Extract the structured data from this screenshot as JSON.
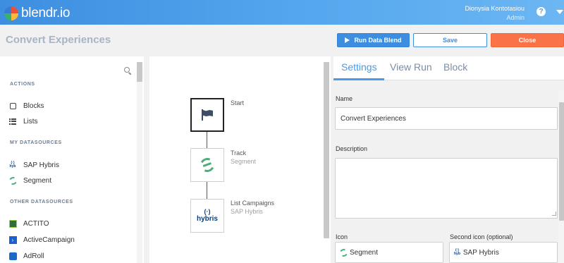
{
  "app": {
    "brand": "blendr.io"
  },
  "user": {
    "name": "Dionysia Kontotasiou",
    "role": "Admin"
  },
  "header": {
    "help_glyph": "?"
  },
  "page": {
    "title": "Convert Experiences"
  },
  "toolbar": {
    "run_label": "Run Data Blend",
    "save_label": "Save",
    "close_label": "Close"
  },
  "sidebar": {
    "actions_heading": "ACTIONS",
    "actions": [
      {
        "label": "Blocks",
        "icon": "square-icon"
      },
      {
        "label": "Lists",
        "icon": "list-icon"
      }
    ],
    "my_heading": "MY DATASOURCES",
    "my_datasources": [
      {
        "label": "SAP Hybris",
        "icon": "sap-hybris-icon"
      },
      {
        "label": "Segment",
        "icon": "segment-icon"
      }
    ],
    "other_heading": "OTHER DATASOURCES",
    "other_datasources": [
      {
        "label": "ACTITO",
        "icon": "actito-icon"
      },
      {
        "label": "ActiveCampaign",
        "icon": "activecampaign-icon"
      },
      {
        "label": "AdRoll",
        "icon": "adroll-icon"
      }
    ]
  },
  "flow": {
    "nodes": [
      {
        "title": "Start",
        "subtitle": ""
      },
      {
        "title": "Track",
        "subtitle": "Segment"
      },
      {
        "title": "List Campaigns",
        "subtitle": "SAP Hybris"
      }
    ],
    "hybris_logo_top": "(·)",
    "hybris_logo_bottom": "hybris"
  },
  "panel": {
    "tabs": [
      {
        "label": "Settings",
        "active": true
      },
      {
        "label": "View Run",
        "active": false
      },
      {
        "label": "Block",
        "active": false
      }
    ],
    "name_label": "Name",
    "name_value": "Convert Experiences",
    "description_label": "Description",
    "description_value": "",
    "icon_label": "Icon",
    "icon_value": "Segment",
    "second_icon_label": "Second icon (optional)",
    "second_icon_value": "SAP Hybris"
  },
  "colors": {
    "accent": "#4a9ae8",
    "run_button": "#3d8ee0",
    "close_button": "#f97248",
    "segment_green": "#4caf78",
    "hybris_blue": "#0b3d7a"
  }
}
